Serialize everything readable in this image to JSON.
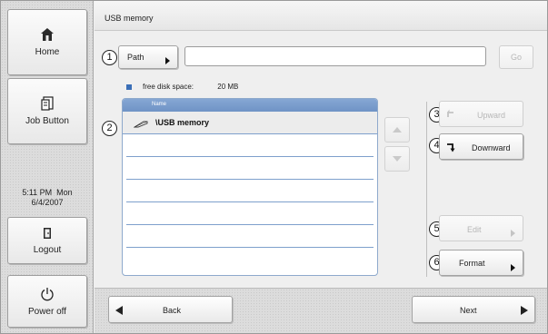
{
  "sidebar": {
    "home_label": "Home",
    "job_label": "Job Button",
    "time": "5:11 PM  Mon",
    "date": "6/4/2007",
    "logout_label": "Logout",
    "power_label": "Power off"
  },
  "header": {
    "title": "USB memory"
  },
  "path": {
    "label": "Path",
    "value": "",
    "go_label": "Go",
    "callout": "1"
  },
  "disk": {
    "label": "free disk space:",
    "value": "20 MB"
  },
  "list": {
    "callout": "2",
    "column_header": "Name",
    "rows": [
      {
        "label": "\\USB memory"
      },
      {
        "label": ""
      },
      {
        "label": ""
      },
      {
        "label": ""
      },
      {
        "label": ""
      },
      {
        "label": ""
      },
      {
        "label": ""
      }
    ]
  },
  "actions": {
    "upward_label": "Upward",
    "upward_callout": "3",
    "downward_label": "Downward",
    "downward_callout": "4",
    "edit_label": "Edit",
    "edit_callout": "5",
    "format_label": "Format",
    "format_callout": "6"
  },
  "footer": {
    "back_label": "Back",
    "next_label": "Next"
  },
  "colors": {
    "list_header": "#6f93c6",
    "row_rule": "#7ea0cc",
    "disk_marker": "#3a6fb7"
  },
  "icons": [
    "home-icon",
    "job-icon",
    "logout-icon",
    "power-icon",
    "drive-icon",
    "up-arrow-icon",
    "down-arrow-icon",
    "upward-icon",
    "downward-icon",
    "back-arrow-icon",
    "next-arrow-icon"
  ]
}
